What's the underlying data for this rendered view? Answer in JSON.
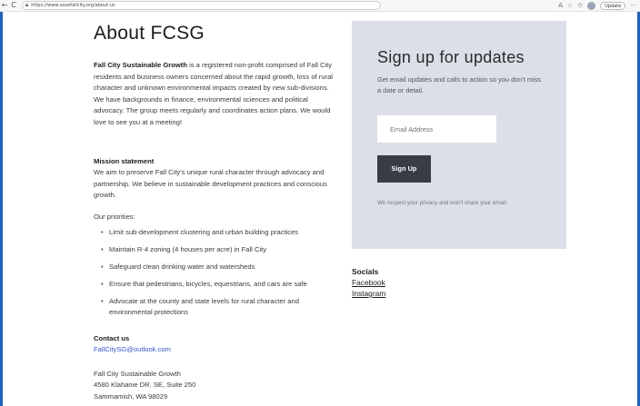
{
  "browser": {
    "back": "←",
    "reload": "C",
    "url": "https://www.savefallcity.org/about-us",
    "icons": [
      "read-aloud-icon",
      "favorite-star-icon",
      "favorites-icon",
      "profile-icon"
    ],
    "update_label": "Update",
    "more": "···"
  },
  "page": {
    "title": "About FCSG",
    "intro_bold": "Fall City Sustainable Growth",
    "intro_rest": " is a registered non-profit comprised of Fall City residents and business owners concerned about the rapid growth, loss of rural character and unknown environmental impacts created by new sub-divisions. We have backgrounds in finance, environmental sciences and political advocacy. The group meets regularly and coordinates action plans. We would love to see you at a meeting!",
    "mission_heading": "Mission statement",
    "mission_text": "We aim to preserve Fall City's unique rural character through advocacy and partnership. We believe in sustainable development practices and conscious growth.",
    "priorities_heading": "Our priorities:",
    "priorities": [
      "Limit sub-development clustering and urban building practices",
      "Maintain R-4 zoning (4 houses per acre) in Fall City",
      "Safeguard clean drinking water and watersheds",
      "Ensure that pedestrians, bicycles, equestrians, and cars are safe",
      "Advocate at the county and state levels for rural character and environmental protections"
    ],
    "contact_heading": "Contact us",
    "contact_email": "FallCitySG@outlook.com",
    "address": [
      "Fall City Sustainable Growth",
      "4580 Klahanie DR. SE, Suite 250",
      "Sammamish, WA 98029"
    ]
  },
  "signup": {
    "title": "Sign up for updates",
    "description": "Get email updates and calls to action so you don't miss a date or detail.",
    "email_placeholder": "Email Address",
    "button_label": "Sign Up",
    "privacy": "We respect your privacy and won't share your email."
  },
  "socials": {
    "heading": "Socials",
    "links": [
      "Facebook",
      "Instagram"
    ]
  },
  "colors": {
    "panel": "#dcdfe8",
    "button": "#383c45",
    "link": "#3a56c8",
    "frame": "#1f63b8"
  }
}
